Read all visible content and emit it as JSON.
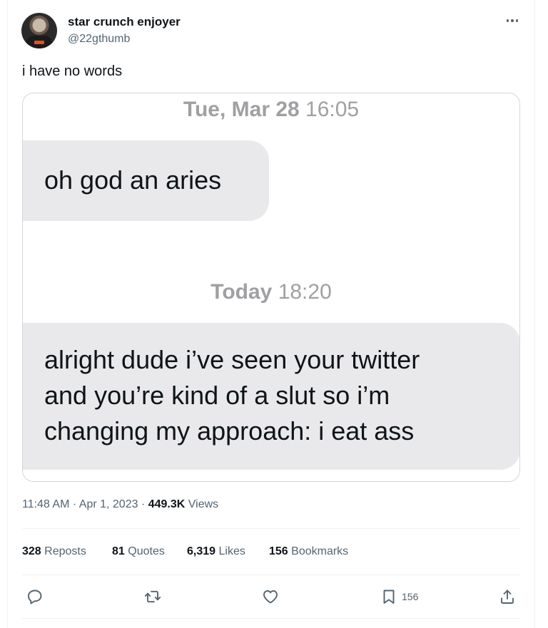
{
  "author": {
    "display_name": "star crunch enjoyer",
    "handle": "@22gthumb",
    "avatar": "profile-photo"
  },
  "tweet": {
    "text": "i have no words"
  },
  "screenshot": {
    "stamp1_day": "Tue, Mar 28",
    "stamp1_time": "16:05",
    "message1": "oh god an aries",
    "stamp2_day": "Today",
    "stamp2_time": "18:20",
    "message2_lines": [
      "alright dude i’ve seen your twitter",
      "and you’re kind of a slut so i’m",
      "changing my approach: i eat ass"
    ]
  },
  "meta": {
    "time": "11:48 AM",
    "separator": "·",
    "date": "Apr 1, 2023",
    "views_count": "449.3K",
    "views_label": "Views"
  },
  "stats": {
    "reposts_count": "328",
    "reposts_label": "Reposts",
    "quotes_count": "81",
    "quotes_label": "Quotes",
    "likes_count": "6,319",
    "likes_label": "Likes",
    "bookmarks_count": "156",
    "bookmarks_label": "Bookmarks"
  },
  "actions": {
    "bookmark_count": "156",
    "icons": [
      "reply-icon",
      "repost-icon",
      "like-icon",
      "bookmark-icon",
      "share-icon"
    ]
  },
  "colors": {
    "text_primary": "#0f1419",
    "text_secondary": "#536471",
    "bubble": "#e9e9eb",
    "stamp": "#a0a0a4",
    "border": "#cfd9de"
  }
}
